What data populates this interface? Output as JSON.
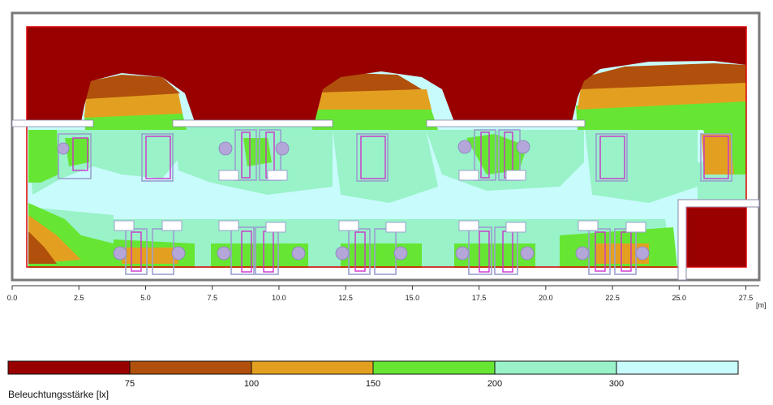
{
  "diagram": {
    "type": "illuminance-false-color-floor-plan",
    "room_width_m": 28,
    "axis": {
      "ticks": [
        "0.0",
        "2.5",
        "5.0",
        "7.5",
        "10.0",
        "12.5",
        "15.0",
        "17.5",
        "20.0",
        "22.5",
        "25.0",
        "27.5"
      ],
      "unit": "[m]"
    },
    "legend": {
      "title": "Beleuchtungsstärke [lx]",
      "thresholds": [
        "75",
        "100",
        "150",
        "200",
        "300"
      ],
      "colors": [
        "#990000",
        "#b0500c",
        "#e3a020",
        "#66e633",
        "#99f2c8",
        "#c8fbfb"
      ]
    },
    "colors": {
      "outline": "#888888",
      "room_border": "#e00000",
      "bed": "#9aa0d0",
      "accent": "#cc33cc"
    }
  }
}
